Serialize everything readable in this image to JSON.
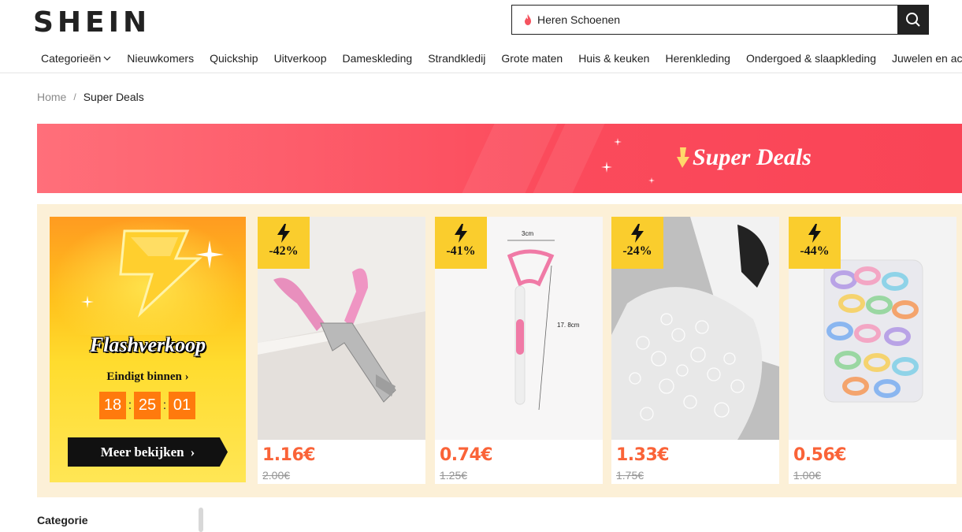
{
  "header": {
    "logo": "SHEIN",
    "search": {
      "placeholder": "Heren Schoenen"
    }
  },
  "nav": {
    "items": [
      "Categorieën",
      "Nieuwkomers",
      "Quickship",
      "Uitverkoop",
      "Dameskleding",
      "Strandkledij",
      "Grote maten",
      "Huis & keuken",
      "Herenkleding",
      "Ondergoed & slaapkleding",
      "Juwelen en accessoires"
    ]
  },
  "breadcrumb": {
    "home": "Home",
    "separator": "/",
    "current": "Super Deals"
  },
  "banner": {
    "title": "Super Deals"
  },
  "flash": {
    "title": "Flashverkoop",
    "ends_label": "Eindigt binnen",
    "countdown": {
      "hours": "18",
      "minutes": "25",
      "seconds": "01"
    },
    "button": "Meer bekijken"
  },
  "products": [
    {
      "discount": "-42%",
      "price": "1.16€",
      "original_price": "2.00€",
      "image": "nail-clipper"
    },
    {
      "discount": "-41%",
      "price": "0.74€",
      "original_price": "1.25€",
      "image": "tongue-scraper",
      "dim_width": "3cm",
      "dim_length": "17. 8cm"
    },
    {
      "discount": "-24%",
      "price": "1.33€",
      "original_price": "1.75€",
      "image": "clear-rubber-bands"
    },
    {
      "discount": "-44%",
      "price": "0.56€",
      "original_price": "1.00€",
      "image": "colorful-hair-ties"
    }
  ],
  "sidebar": {
    "category_label": "Categorie"
  },
  "colors": {
    "accent": "#fa6338",
    "banner": "#fb4b5c",
    "badge": "#facd2d",
    "countdown": "#ff7a0d",
    "panel": "#fcf0d7"
  }
}
